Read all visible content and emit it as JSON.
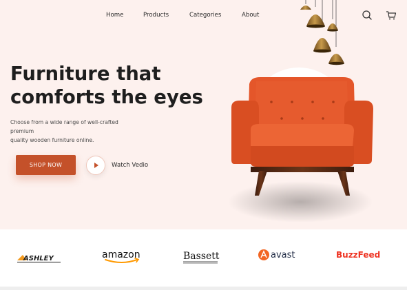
{
  "nav": {
    "links": [
      "Home",
      "Products",
      "Categories",
      "About"
    ],
    "search_icon": "search-icon",
    "cart_icon": "cart-icon"
  },
  "hero": {
    "headline": [
      "Furniture that",
      "comforts the eyes"
    ],
    "description": [
      "Choose from a wide range of well-crafted",
      "premium",
      "quality wooden furniture online."
    ],
    "shop_button": "SHOP NOW",
    "watch_label": "Watch Vedio",
    "product_image": "orange-armchair",
    "lamps_image": "pendant-lamps"
  },
  "brands": [
    {
      "name": "ASHLEY",
      "color": "#1a1a1a",
      "accent": "#f39a1e"
    },
    {
      "name": "amazon",
      "color": "#111111",
      "accent": "#ff9900"
    },
    {
      "name": "Bassett",
      "color": "#111111"
    },
    {
      "name": "avast",
      "color": "#1f2a44",
      "accent": "#f26522"
    },
    {
      "name": "BuzzFeed",
      "color": "#ee3322"
    }
  ],
  "colors": {
    "hero_bg": "#fdf1ee",
    "accent": "#c4512a",
    "chair": "#e85a2a"
  }
}
